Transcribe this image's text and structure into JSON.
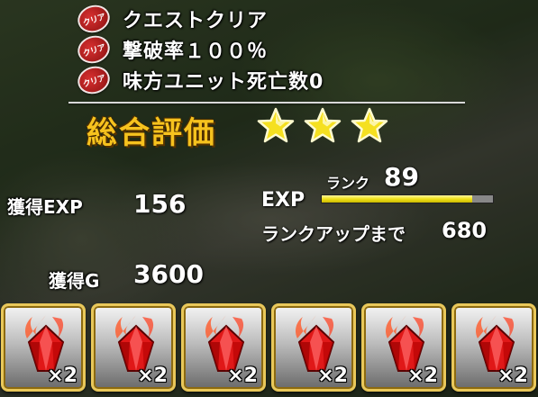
{
  "quests": [
    {
      "stamp": "クリア",
      "label": "クエストクリア"
    },
    {
      "stamp": "クリア",
      "label": "撃破率１００％"
    },
    {
      "stamp": "クリア",
      "label": "味方ユニット死亡数0"
    }
  ],
  "overall": {
    "label": "総合評価",
    "stars": 3,
    "star_color": "#f5e020"
  },
  "gains": {
    "exp_label": "獲得EXP",
    "exp_value": "156",
    "g_label": "獲得G",
    "g_value": "3600"
  },
  "rank": {
    "exp_label": "EXP",
    "rank_label": "ランク",
    "rank_value": "89",
    "exp_progress": 0.88,
    "rankup_label": "ランクアップまで",
    "rankup_value": "680"
  },
  "rewards": [
    {
      "icon": "red-crystal-icon",
      "qty": "×2"
    },
    {
      "icon": "red-crystal-icon",
      "qty": "×2"
    },
    {
      "icon": "red-crystal-icon",
      "qty": "×2"
    },
    {
      "icon": "red-crystal-icon",
      "qty": "×2"
    },
    {
      "icon": "red-crystal-icon",
      "qty": "×2"
    },
    {
      "icon": "red-crystal-icon",
      "qty": "×2"
    }
  ],
  "colors": {
    "accent_gold": "#f6c21e",
    "crystal_red": "#e01818",
    "bar_yellow": "#f1e21a"
  }
}
